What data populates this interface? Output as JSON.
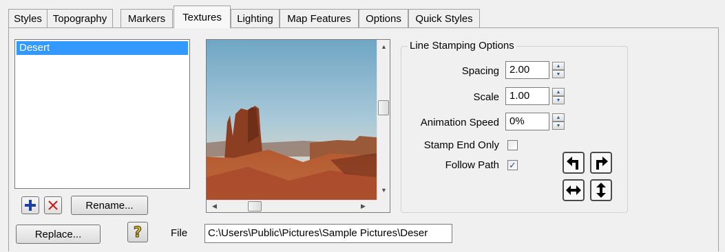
{
  "tabs": [
    "Styles",
    "Topography",
    "Markers",
    "Textures",
    "Lighting",
    "Map Features",
    "Options",
    "Quick Styles"
  ],
  "active_tab": "Textures",
  "texture_list": {
    "items": [
      "Desert"
    ],
    "selected": "Desert"
  },
  "list_buttons": {
    "add_icon": "plus-icon",
    "delete_icon": "x-icon",
    "rename_label": "Rename..."
  },
  "replace_label": "Replace...",
  "help_icon": "question-mark-icon",
  "file": {
    "label": "File",
    "value": "C:\\Users\\Public\\Pictures\\Sample Pictures\\Deser"
  },
  "line_stamping": {
    "title": "Line Stamping Options",
    "spacing_label": "Spacing",
    "spacing_value": "2.00",
    "scale_label": "Scale",
    "scale_value": "1.00",
    "animation_label": "Animation Speed",
    "animation_value": "0%",
    "stamp_end_label": "Stamp End Only",
    "stamp_end_checked": false,
    "follow_path_label": "Follow Path",
    "follow_path_checked": true
  },
  "direction_buttons": [
    "turn-left-icon",
    "turn-right-icon",
    "horizontal-arrows-icon",
    "vertical-arrows-icon"
  ]
}
